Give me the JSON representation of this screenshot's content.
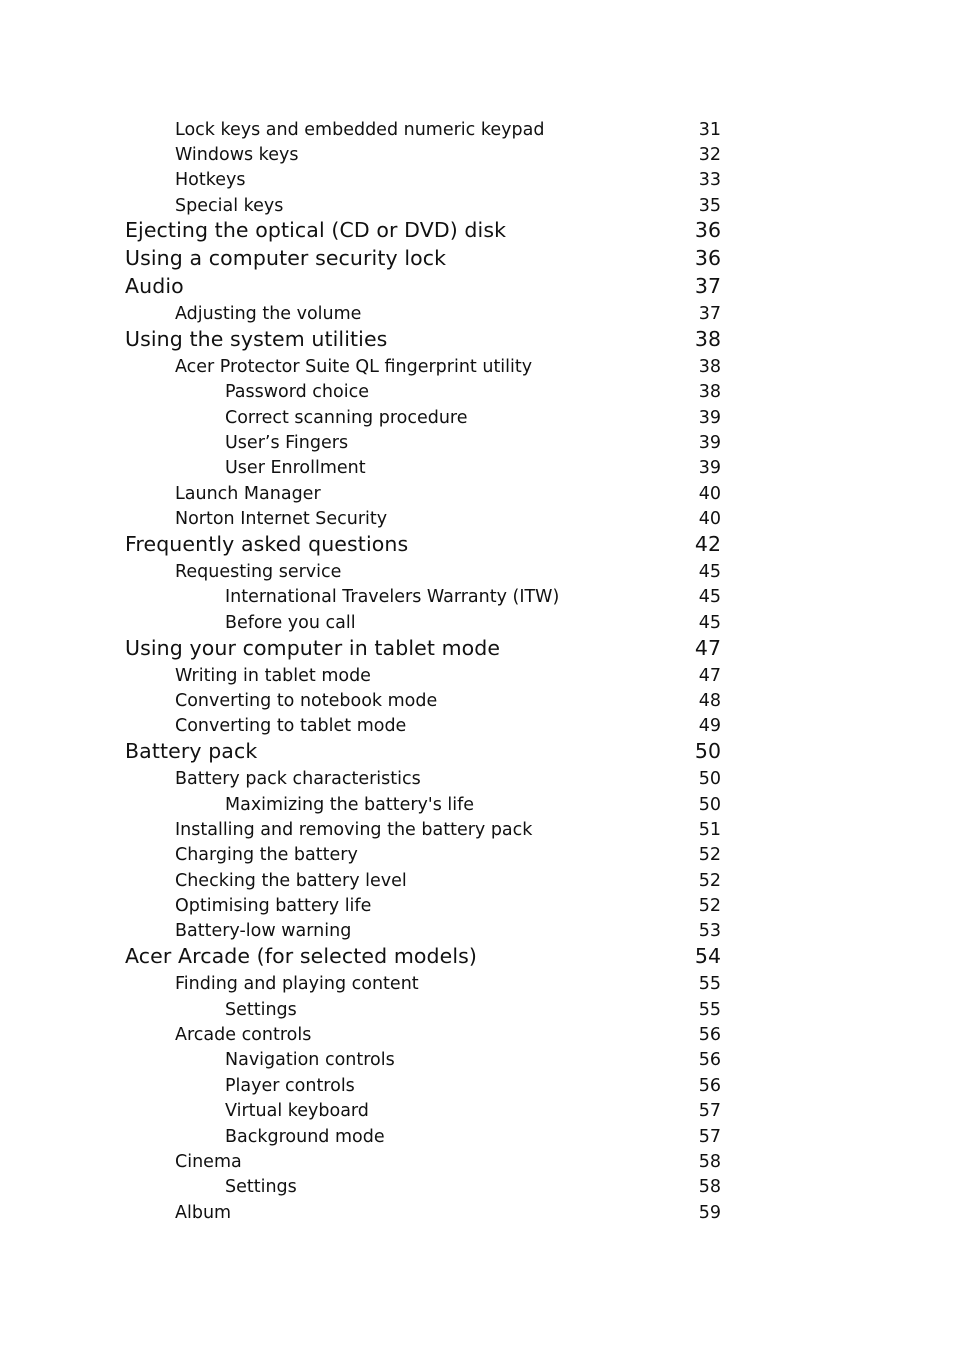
{
  "toc": {
    "entries": [
      {
        "level": 2,
        "title": "Lock keys and embedded numeric keypad",
        "page": "31"
      },
      {
        "level": 2,
        "title": "Windows keys",
        "page": "32"
      },
      {
        "level": 2,
        "title": "Hotkeys",
        "page": "33"
      },
      {
        "level": 2,
        "title": "Special keys",
        "page": "35"
      },
      {
        "level": 1,
        "title": "Ejecting the optical (CD or DVD) disk",
        "page": "36"
      },
      {
        "level": 1,
        "title": "Using a computer security lock",
        "page": "36"
      },
      {
        "level": 1,
        "title": "Audio",
        "page": "37"
      },
      {
        "level": 2,
        "title": "Adjusting the volume",
        "page": "37"
      },
      {
        "level": 1,
        "title": "Using the system utilities",
        "page": "38"
      },
      {
        "level": 2,
        "title": "Acer Protector Suite QL fingerprint utility",
        "page": "38"
      },
      {
        "level": 3,
        "title": "Password choice",
        "page": "38"
      },
      {
        "level": 3,
        "title": "Correct scanning procedure",
        "page": "39"
      },
      {
        "level": 3,
        "title": "User’s Fingers",
        "page": "39"
      },
      {
        "level": 3,
        "title": "User Enrollment",
        "page": "39"
      },
      {
        "level": 2,
        "title": "Launch Manager",
        "page": "40"
      },
      {
        "level": 2,
        "title": "Norton Internet Security",
        "page": "40"
      },
      {
        "level": 1,
        "title": "Frequently asked questions",
        "page": "42"
      },
      {
        "level": 2,
        "title": "Requesting service",
        "page": "45"
      },
      {
        "level": 3,
        "title": "International Travelers Warranty (ITW)",
        "page": "45"
      },
      {
        "level": 3,
        "title": "Before you call",
        "page": "45"
      },
      {
        "level": 1,
        "title": "Using your computer in tablet mode",
        "page": "47"
      },
      {
        "level": 2,
        "title": "Writing in tablet mode",
        "page": "47"
      },
      {
        "level": 2,
        "title": "Converting to notebook mode",
        "page": "48"
      },
      {
        "level": 2,
        "title": "Converting to tablet mode",
        "page": "49"
      },
      {
        "level": 1,
        "title": "Battery pack",
        "page": "50"
      },
      {
        "level": 2,
        "title": "Battery pack characteristics",
        "page": "50"
      },
      {
        "level": 3,
        "title": "Maximizing the battery's life",
        "page": "50"
      },
      {
        "level": 2,
        "title": "Installing and removing the battery pack",
        "page": "51"
      },
      {
        "level": 2,
        "title": "Charging the battery",
        "page": "52"
      },
      {
        "level": 2,
        "title": "Checking the battery level",
        "page": "52"
      },
      {
        "level": 2,
        "title": "Optimising battery life",
        "page": "52"
      },
      {
        "level": 2,
        "title": "Battery-low warning",
        "page": "53"
      },
      {
        "level": 1,
        "title": "Acer Arcade (for selected models)",
        "page": "54"
      },
      {
        "level": 2,
        "title": "Finding and playing content",
        "page": "55"
      },
      {
        "level": 3,
        "title": "Settings",
        "page": "55"
      },
      {
        "level": 2,
        "title": "Arcade controls",
        "page": "56"
      },
      {
        "level": 3,
        "title": "Navigation controls",
        "page": "56"
      },
      {
        "level": 3,
        "title": "Player controls",
        "page": "56"
      },
      {
        "level": 3,
        "title": "Virtual keyboard",
        "page": "57"
      },
      {
        "level": 3,
        "title": "Background mode",
        "page": "57"
      },
      {
        "level": 2,
        "title": "Cinema",
        "page": "58"
      },
      {
        "level": 3,
        "title": "Settings",
        "page": "58"
      },
      {
        "level": 2,
        "title": "Album",
        "page": "59"
      }
    ]
  }
}
